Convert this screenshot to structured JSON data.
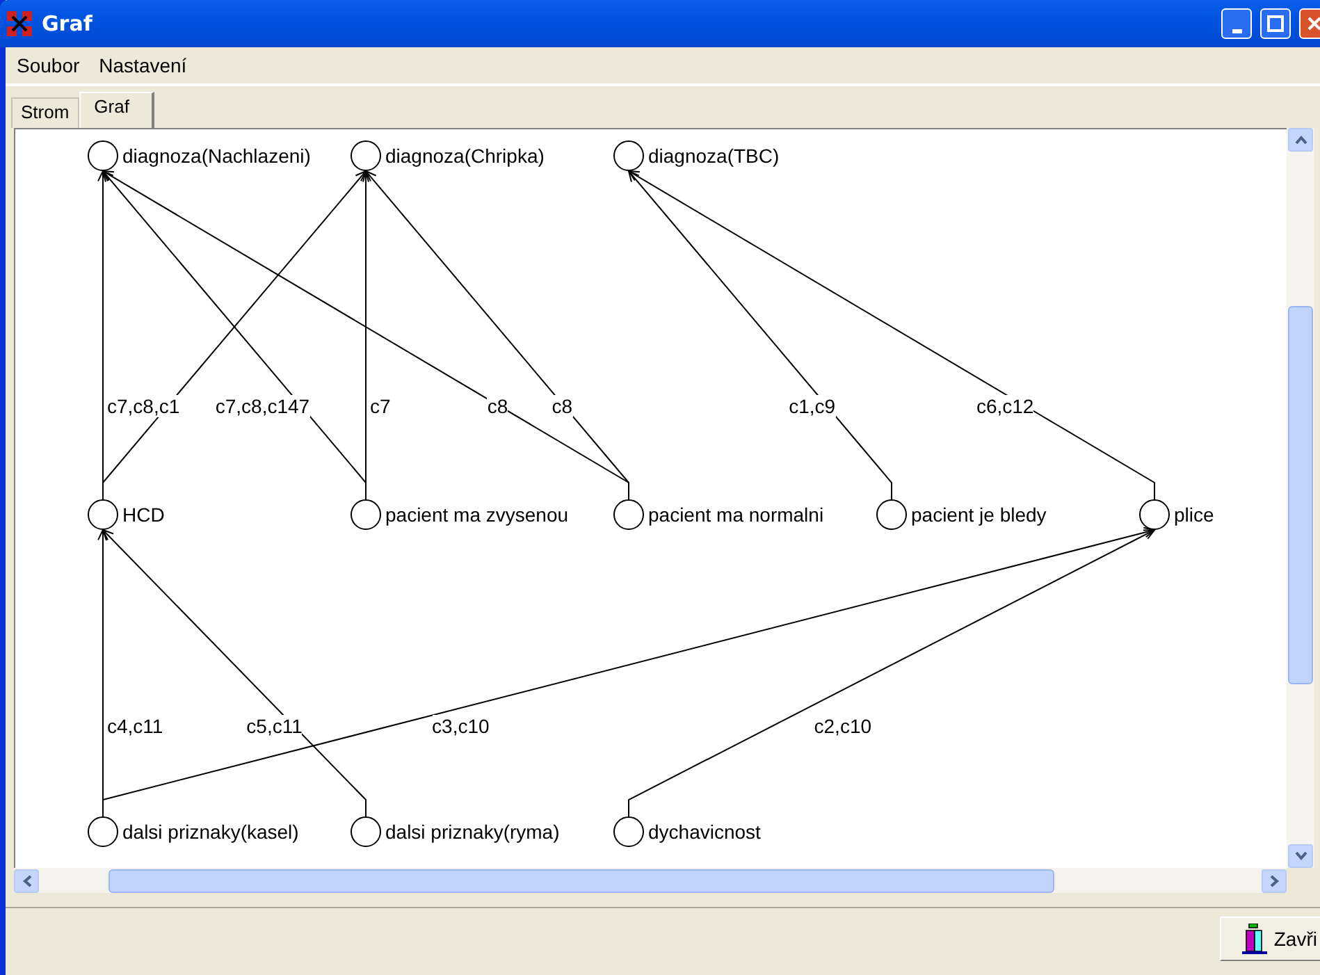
{
  "window": {
    "title": "Graf"
  },
  "menu": [
    "Soubor",
    "Nastavení"
  ],
  "tabs": [
    {
      "label": "Strom",
      "selected": false
    },
    {
      "label": "Graf",
      "selected": true
    }
  ],
  "graph": {
    "levels": [
      [
        {
          "label": "diagnoza(Nachlazeni)"
        },
        {
          "label": "diagnoza(Chripka)"
        },
        {
          "label": "diagnoza(TBC)"
        }
      ],
      [
        {
          "label": "HCD",
          "edge_labels": [
            "c7,c8,c1"
          ]
        },
        {
          "label": "pacient ma zvysenou",
          "edge_labels": [
            "c7,c8,c147",
            "c7"
          ]
        },
        {
          "label": "pacient ma normalni",
          "edge_labels": [
            "c8",
            "c8"
          ]
        },
        {
          "label": "pacient je bledy",
          "edge_labels": [
            "c1,c9"
          ]
        },
        {
          "label": "plice",
          "edge_labels": [
            "c6,c12"
          ]
        }
      ],
      [
        {
          "label": "dalsi priznaky(kasel)",
          "edge_labels": [
            "c4,c11",
            "c3,c10"
          ]
        },
        {
          "label": "dalsi priznaky(ryma)",
          "edge_labels": [
            "c5,c11"
          ]
        },
        {
          "label": "dychavicnost",
          "edge_labels": [
            "c2,c10"
          ]
        }
      ]
    ]
  },
  "close_button": {
    "label": "Zavři"
  }
}
